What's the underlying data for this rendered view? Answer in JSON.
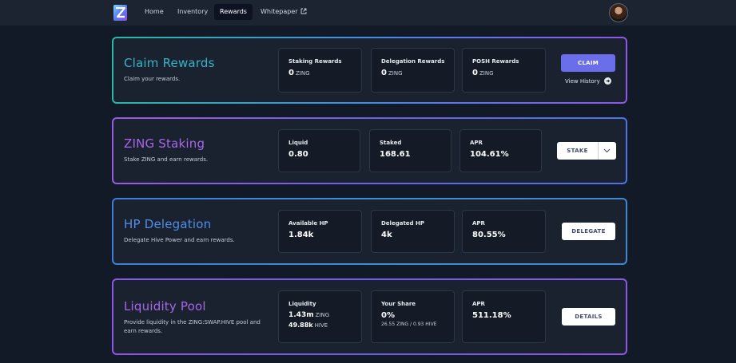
{
  "nav": {
    "links": [
      {
        "label": "Home"
      },
      {
        "label": "Inventory"
      },
      {
        "label": "Rewards"
      },
      {
        "label": "Whitepaper"
      }
    ],
    "active": "Rewards",
    "colors": {
      "bg": "#1c2432",
      "active_bg": "#0d1320"
    }
  },
  "claim": {
    "title": "Claim Rewards",
    "subtitle": "Claim your rewards.",
    "stats": [
      {
        "label": "Staking Rewards",
        "value": "0",
        "unit": "ZING"
      },
      {
        "label": "Delegation Rewards",
        "value": "0",
        "unit": "ZING"
      },
      {
        "label": "POSH Rewards",
        "value": "0",
        "unit": "ZING"
      }
    ],
    "button": "CLAIM",
    "history_label": "View History"
  },
  "staking": {
    "title": "ZING Staking",
    "subtitle": "Stake ZING and earn rewards.",
    "stats": [
      {
        "label": "Liquid",
        "value": "0.80"
      },
      {
        "label": "Staked",
        "value": "168.61"
      },
      {
        "label": "APR",
        "value": "104.61%"
      }
    ],
    "button": "STAKE"
  },
  "delegation": {
    "title": "HP Delegation",
    "subtitle": "Delegate Hive Power and earn rewards.",
    "stats": [
      {
        "label": "Available HP",
        "value": "1.84k"
      },
      {
        "label": "Delegated HP",
        "value": "4k"
      },
      {
        "label": "APR",
        "value": "80.55%"
      }
    ],
    "button": "DELEGATE"
  },
  "pool": {
    "title": "Liquidity Pool",
    "subtitle_line1": "Provide liquidity in the ZING:SWAP.HIVE pool and",
    "subtitle_line2": "earn rewards.",
    "liquidity": {
      "label": "Liquidity",
      "value1": "1.43m",
      "unit1": "ZING",
      "value2": "49.88k",
      "unit2": "HIVE"
    },
    "share": {
      "label": "Your Share",
      "value": "0%",
      "zing": "26.55",
      "zing_unit": "ZING",
      "sep": "/",
      "hive": "0.93",
      "hive_unit": "HIVE"
    },
    "apr": {
      "label": "APR",
      "value": "511.18%"
    },
    "button": "DETAILS"
  },
  "accent_colors": {
    "teal": "#37b3c8",
    "purple": "#a866ea",
    "blue": "#4f8fe6",
    "claim_button": "#6a6ee8"
  }
}
